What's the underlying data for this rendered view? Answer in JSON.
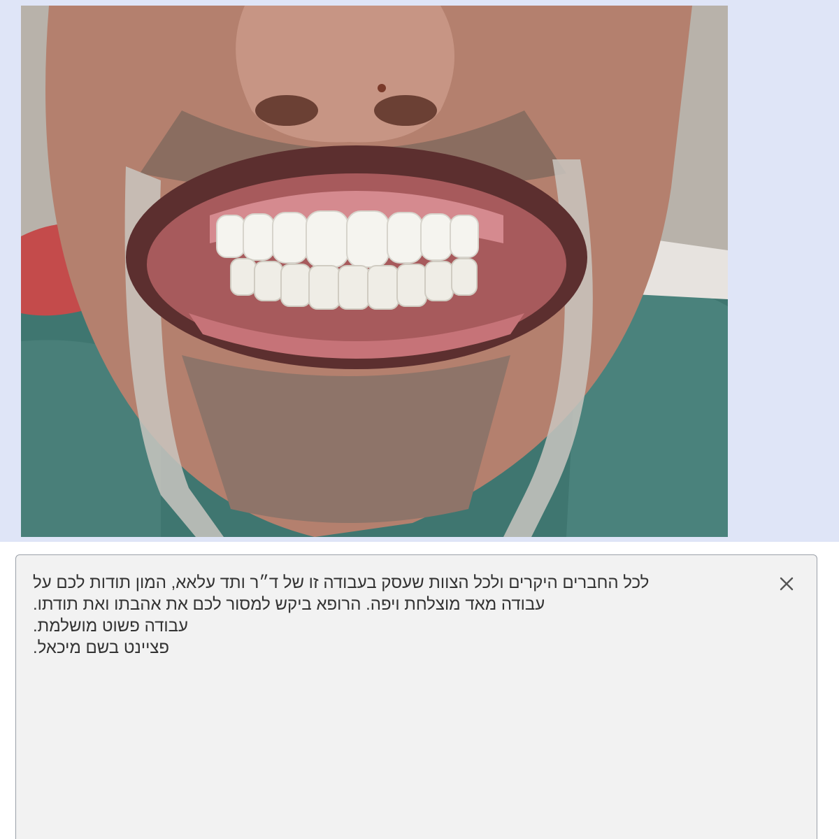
{
  "review": {
    "lines": [
      "לכל החברים היקרים ולכל הצוות שעסק בעבודה זו של ד״ר ותד עלאא, המון תודות לכם על",
      "עבודה מאד מוצלחת ויפה. הרופא ביקש למסור לכם את אהבתו ואת תודתו.",
      "עבודה פשוט מושלמת.",
      "פציינט בשם מיכאל."
    ]
  },
  "icons": {
    "close": "close-icon"
  },
  "colors": {
    "page_background": "#dfe5f7",
    "box_background": "#f2f2f2",
    "box_border": "#9aa0a8",
    "text": "#333333"
  }
}
